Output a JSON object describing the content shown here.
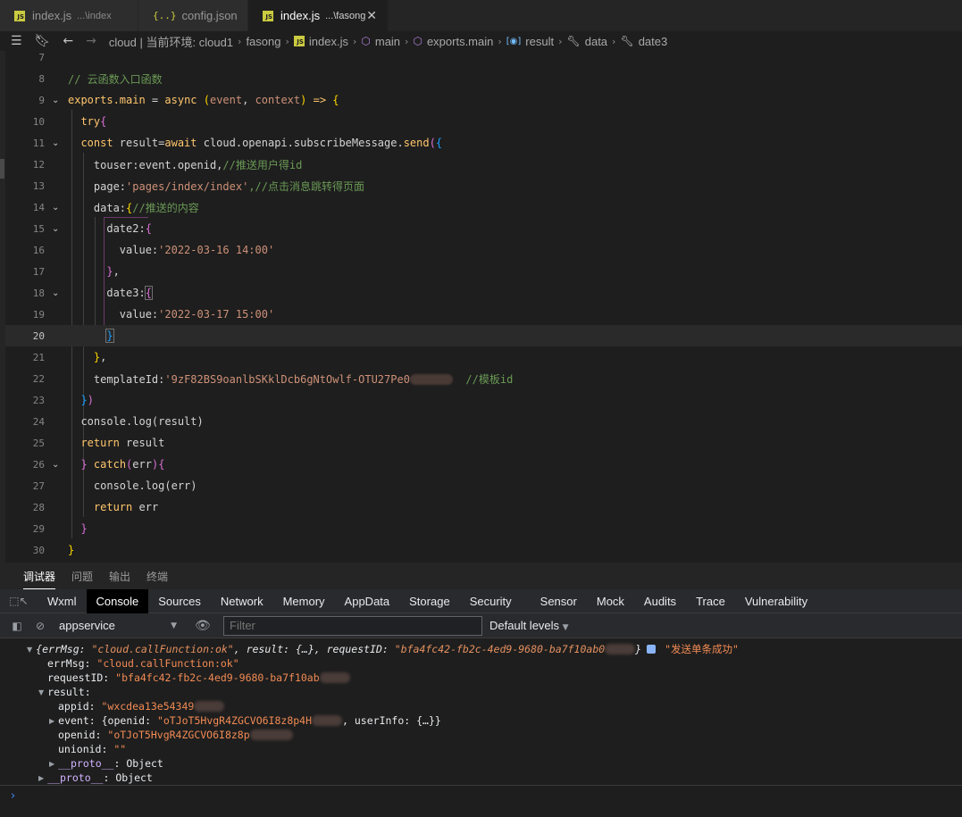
{
  "tabs": [
    {
      "name": "index.js",
      "path": "...\\index",
      "icon": "js-file-icon",
      "active": false
    },
    {
      "name": "config.json",
      "path": "",
      "icon": "json-file-icon",
      "active": false
    },
    {
      "name": "index.js",
      "path": "...\\fasong",
      "icon": "js-file-icon",
      "active": true
    }
  ],
  "breadcrumb": {
    "env": "cloud | 当前环境: cloud1",
    "folder": "fasong",
    "file": "index.js",
    "symbols": [
      "main",
      "exports.main",
      "result",
      "data",
      "date3"
    ]
  },
  "editor": {
    "current_line": 20,
    "line_numbers": [
      "7",
      "8",
      "9",
      "10",
      "11",
      "12",
      "13",
      "14",
      "15",
      "16",
      "17",
      "18",
      "19",
      "20",
      "21",
      "22",
      "23",
      "24",
      "25",
      "26",
      "27",
      "28",
      "29",
      "30"
    ],
    "comment_entry": "// 云函数入口函数",
    "exports_main": "exports.main",
    "assign": " = ",
    "async": "async",
    "params_event": "event",
    "params_context": "context",
    "arrow": " => ",
    "try": "try",
    "const_kw": "const",
    "result_decl": " result=",
    "await_kw": "await",
    "call_path": " cloud.openapi.subscribeMessage.",
    "send": "send",
    "touser": "touser:event.openid,",
    "touser_comment": "//推送用户得id",
    "page_key": "page:",
    "page_val": "'pages/index/index'",
    "page_comment": ",//点击消息跳转得页面",
    "data_key": "data:",
    "data_comment": "//推送的内容",
    "date2_key": "date2:",
    "value_key": "value:",
    "date2_val": "'2022-03-16 14:00'",
    "date3_key": "date3:",
    "date3_val": "'2022-03-17 15:00'",
    "template_key": "templateId:",
    "template_val": "'9zF82BS9oanlbSKklDcb6gNtOwlf-OTU27Pe0",
    "template_comment": "//模板id",
    "console_log_result": "console.log(result)",
    "return_kw": "return",
    "result_word": " result",
    "catch_kw": "catch",
    "err_word": "err",
    "console_log_err": "console.log(err)",
    "return_err": " err"
  },
  "panel_tabs": [
    "调试器",
    "问题",
    "输出",
    "终端"
  ],
  "devtools_tabs": [
    "Wxml",
    "Console",
    "Sources",
    "Network",
    "Memory",
    "AppData",
    "Storage",
    "Security",
    "Sensor",
    "Mock",
    "Audits",
    "Trace",
    "Vulnerability"
  ],
  "devtools_active": "Console",
  "console_toolbar": {
    "context": "appservice",
    "filter_placeholder": "Filter",
    "levels": "Default levels"
  },
  "console_output": {
    "summary_open": "{",
    "summary_errmsg_key": "errMsg: ",
    "summary_errmsg_val": "\"cloud.callFunction:ok\"",
    "summary_result": ", result: {…}, ",
    "summary_reqid_key": "requestID: ",
    "summary_reqid_val": "\"bfa4fc42-fb2c-4ed9-9680-ba7f10ab0",
    "summary_close": "}",
    "message": "\"发送单条成功\"",
    "errMsg_key": "errMsg: ",
    "errMsg_val": "\"cloud.callFunction:ok\"",
    "requestID_key": "requestID: ",
    "requestID_val": "\"bfa4fc42-fb2c-4ed9-9680-ba7f10ab",
    "result_key": "result:",
    "appid_key": "appid: ",
    "appid_val": "\"wxcdea13e54349",
    "event_key": "event: ",
    "event_open": "{openid: ",
    "event_openid_val": "\"oTJoT5HvgR4ZGCVO6I8z8p4H",
    "event_rest": ", userInfo: {…}}",
    "openid_key": "openid: ",
    "openid_val": "\"oTJoT5HvgR4ZGCVO6I8z8p",
    "unionid_key": "unionid: ",
    "unionid_val": "\"\"",
    "proto_key": "__proto__",
    "proto_val": ": Object"
  },
  "colors": {
    "editor_bg": "#1e1e1e",
    "keyword_yellow": "#ffc66d",
    "string": "#ce9178",
    "comment": "#6a9955",
    "console_string": "#f28b54",
    "console_key": "#d1b3ff"
  }
}
